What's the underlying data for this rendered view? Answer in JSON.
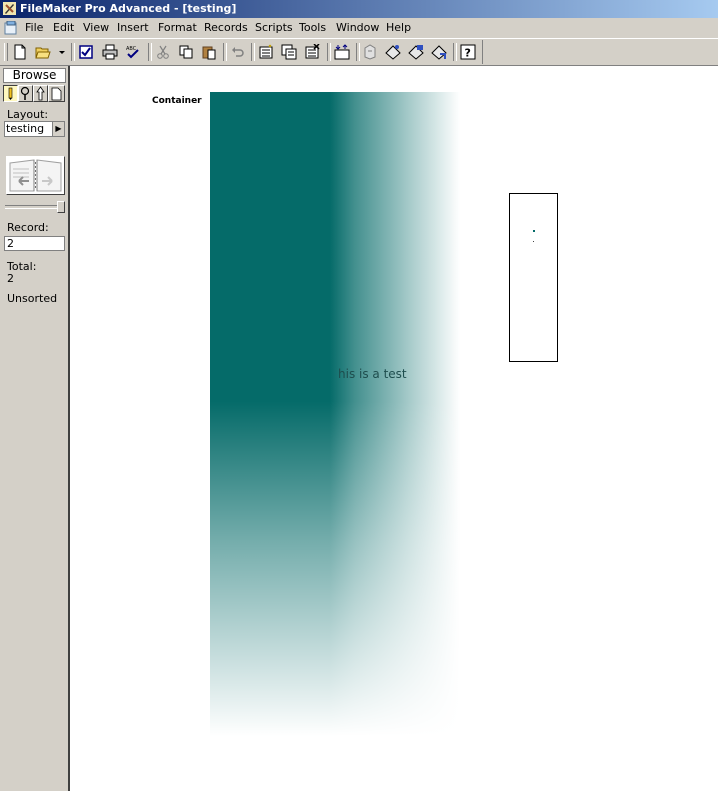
{
  "window": {
    "title": "FileMaker Pro Advanced - [testing]"
  },
  "menu": [
    "File",
    "Edit",
    "View",
    "Insert",
    "Format",
    "Records",
    "Scripts",
    "Tools",
    "Window",
    "Help"
  ],
  "toolbar": {
    "buttons": [
      "new-document",
      "open",
      "open-dropdown",
      "check-spelling",
      "print",
      "spelling",
      "cut",
      "copy",
      "paste",
      "undo",
      "new-record",
      "duplicate-record",
      "delete-record",
      "sort",
      "set-script",
      "send",
      "send-mail",
      "export",
      "help"
    ]
  },
  "status_area": {
    "mode": "Browse",
    "layout_label": "Layout:",
    "layout_value": "testing",
    "record_label": "Record:",
    "record_value": "2",
    "total_label": "Total:",
    "total_value": "2",
    "sort_state": "Unsorted",
    "record_position": 1.0
  },
  "layout": {
    "field_label": "Container",
    "overlay_text": "his is a test"
  },
  "colors": {
    "accent": "#056b69",
    "titlebar": "#0a246a",
    "chrome": "#d4d0c8"
  }
}
